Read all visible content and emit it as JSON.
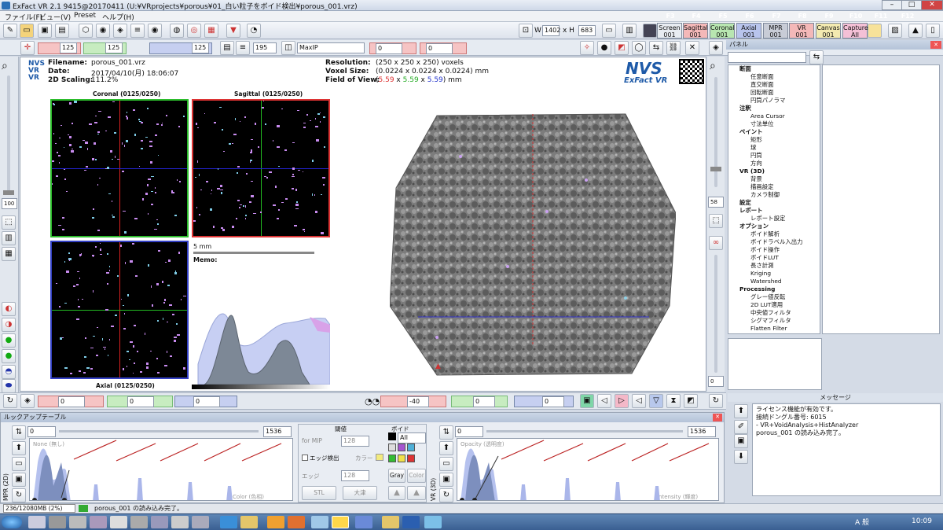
{
  "window": {
    "title": "ExFact VR 2.1 9415@20170411 (U:¥VRprojects¥porous¥01_白い粒子をボイド検出¥porous_001.vrz)"
  },
  "menu": [
    "ファイル(F)",
    "ビュー(V)",
    "Preset",
    "ヘルプ(H)"
  ],
  "toolbar": {
    "width_label": "W",
    "width_value": "1402",
    "height_label": "x H",
    "height_value": "683",
    "fkeys": [
      "F3",
      "F4",
      "F5",
      "F6",
      "F7",
      "F8",
      "F9",
      "F10",
      "F11",
      "F12"
    ],
    "views": [
      {
        "label": "Screen\n001",
        "color": "#e8ecf1"
      },
      {
        "label": "Sagittal\n001",
        "color": "#f4b8b8"
      },
      {
        "label": "Coronal\n001",
        "color": "#b8e6b0"
      },
      {
        "label": "Axial\n001",
        "color": "#b8c4ec"
      },
      {
        "label": "MPR\n001",
        "color": "#c8ccd6"
      },
      {
        "label": "VR\n001",
        "color": "#f4b8b8"
      },
      {
        "label": "Canvas\n001",
        "color": "#f3eab0"
      },
      {
        "label": "Capture\nAll",
        "color": "#f4c0d6"
      }
    ]
  },
  "toolbar2": {
    "sagittal_val": "125",
    "coronal_val": "125",
    "axial_val": "125",
    "thickness": "195",
    "render_mode": "MaxIP",
    "val_a": "0",
    "val_b": "0"
  },
  "info": {
    "filename_label": "Filename:",
    "filename": "porous_001.vrz",
    "date_label": "Date:",
    "date": "2017/04/10(月) 18:06:07",
    "scaling_label": "2D Scaling:",
    "scaling": "111.2%",
    "resolution_label": "Resolution:",
    "resolution": "(250 x 250 x 250) voxels",
    "voxel_label": "Voxel Size:",
    "voxel": "(0.0224 x 0.0224 x 0.0224) mm",
    "fov_label": "Field of View:",
    "fov_a": "5.59",
    "fov_x": " x ",
    "fov_b": "5.59",
    "fov_c": "5.59",
    "fov_unit": ") mm",
    "logo_text": "NVS",
    "logo_sub": "ExFact VR"
  },
  "mpr": {
    "coronal": "Coronal (0125/0250)",
    "sagittal": "Sagittal (0125/0250)",
    "axial": "Axial (0125/0250)",
    "scale": "5 mm",
    "memo": "Memo:"
  },
  "left_nums": {
    "top": "100",
    "right": "58",
    "bottom_right": "0"
  },
  "bottombar": {
    "v1": "0",
    "v2": "0",
    "v3": "0",
    "angle": "-40",
    "r1": "0",
    "r2": "0"
  },
  "panel": {
    "title": "パネル",
    "tree": [
      {
        "t": "断面",
        "sec": true
      },
      {
        "t": "任意断面"
      },
      {
        "t": "直交断面"
      },
      {
        "t": "回転断面"
      },
      {
        "t": "円筒パノラマ"
      },
      {
        "t": "注釈",
        "sec": true
      },
      {
        "t": "Area Cursor"
      },
      {
        "t": "寸法単位"
      },
      {
        "t": "ペイント",
        "sec": true
      },
      {
        "t": "矩形"
      },
      {
        "t": "球"
      },
      {
        "t": "円筒"
      },
      {
        "t": "方向"
      },
      {
        "t": "VR (3D)",
        "sec": true
      },
      {
        "t": "背景"
      },
      {
        "t": "描画設定"
      },
      {
        "t": "カメラ制御"
      },
      {
        "t": "設定",
        "sec": true
      },
      {
        "t": "レポート",
        "sec": true
      },
      {
        "t": "レポート設定"
      },
      {
        "t": "オプション",
        "sec": true
      },
      {
        "t": "ボイド解析"
      },
      {
        "t": "ボイドラベル入出力"
      },
      {
        "t": "ボイド操作"
      },
      {
        "t": "ボイドLUT"
      },
      {
        "t": "長さ計測"
      },
      {
        "t": "Kriging"
      },
      {
        "t": "Watershed"
      },
      {
        "t": "Processing",
        "sec": true
      },
      {
        "t": "グレー値反転"
      },
      {
        "t": "2D LUT適用"
      },
      {
        "t": "中央値フィルタ"
      },
      {
        "t": "シグマフィルタ"
      },
      {
        "t": "Flatten Filter"
      }
    ]
  },
  "messages": {
    "title": "メッセージ",
    "lines": [
      "ライセンス機能が有効です。",
      "接続ドングル番号: 6015",
      "- VR+VoidAnalysis+HistAnalyzer",
      "porous_001 の読み込み完了。"
    ]
  },
  "lut": {
    "title": "ルックアップテーブル",
    "mpr_tab": "MPR (2D)",
    "vr_tab": "VR (3D)",
    "left_min": "0",
    "left_max": "1536",
    "right_min": "0",
    "right_max": "1536",
    "left_caption": "None (無し)",
    "left_footer": "Color (色相)",
    "right_caption": "Opacity (透明度)",
    "right_footer": "Intensity (輝度)",
    "mid_title": "閾値",
    "void_title": "ボイド",
    "void_all": "All",
    "for_mip": "for MIP",
    "mip_val": "128",
    "edge_detect": "エッジ検出",
    "color": "カラー",
    "edge": "エッジ",
    "edge_val": "128",
    "gray": "Gray",
    "color_btn": "Color",
    "stl": "STL",
    "daikai": "大津"
  },
  "status": {
    "memory": "236/12080MB (2%)",
    "message": "porous_001 の読み込み完了。"
  },
  "taskbar": {
    "ime": "A 般",
    "time": "10:09"
  }
}
